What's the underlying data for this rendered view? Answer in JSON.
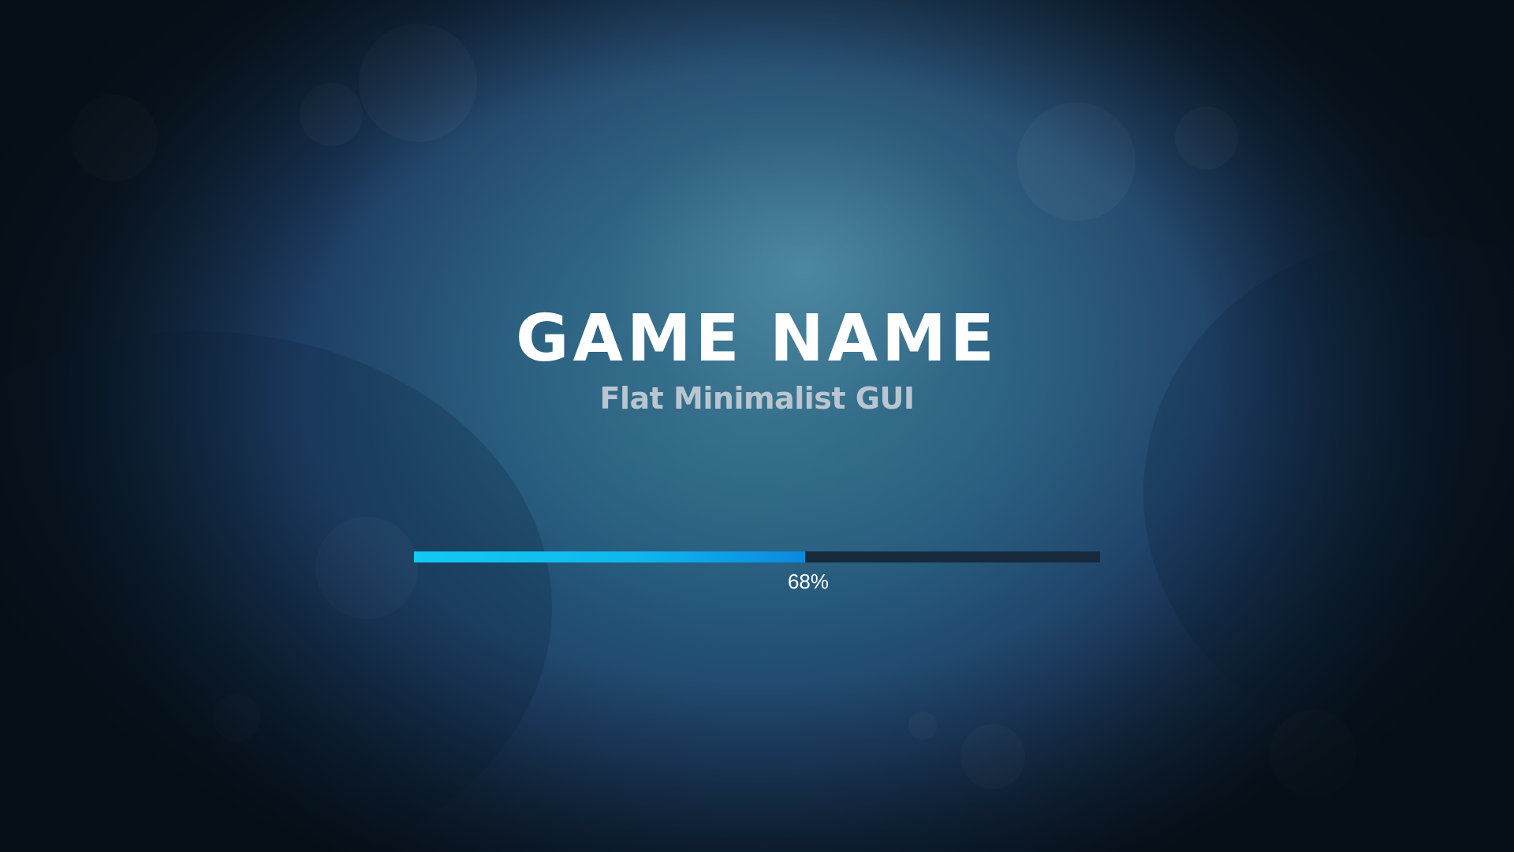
{
  "game": {
    "title": "GAME NAME",
    "subtitle": "Flat Minimalist GUI"
  },
  "loading": {
    "progress": 0.68,
    "label": "68%"
  },
  "colors": {
    "progress_fill": "#12c9f2",
    "progress_track": "#162a3c",
    "title": "#ffffff",
    "subtitle": "#b9c6cf"
  }
}
